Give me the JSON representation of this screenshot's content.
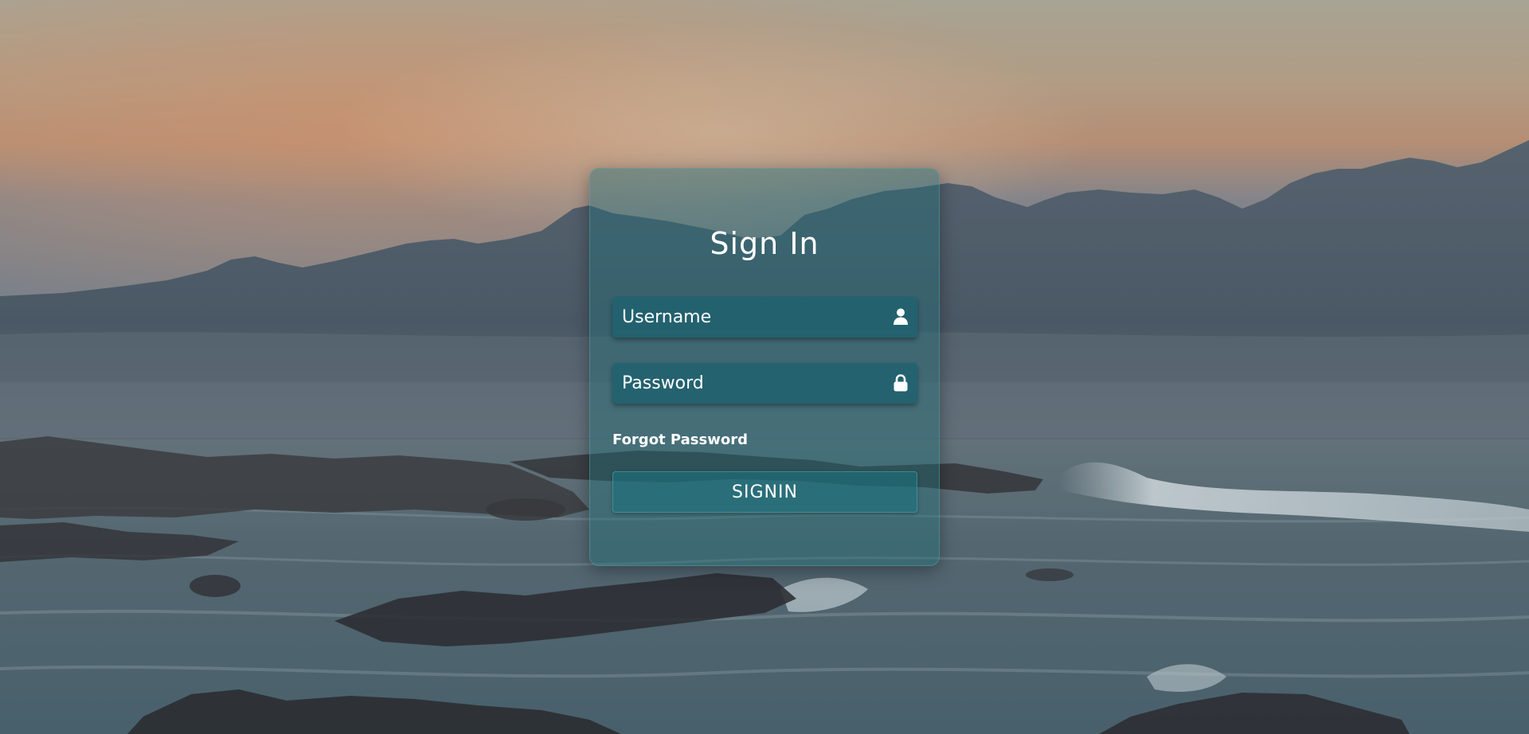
{
  "login": {
    "title": "Sign In",
    "username": {
      "placeholder": "Username",
      "value": "",
      "icon": "user-icon"
    },
    "password": {
      "placeholder": "Password",
      "value": "",
      "icon": "lock-icon"
    },
    "forgot_password": "Forgot Password",
    "submit_label": "SIGNIN"
  },
  "colors": {
    "card_tint": "#1e6e78",
    "input_bg": "#226270",
    "text": "#ffffff",
    "sky_warm": "#d9a27a",
    "sea": "#5f7984"
  }
}
